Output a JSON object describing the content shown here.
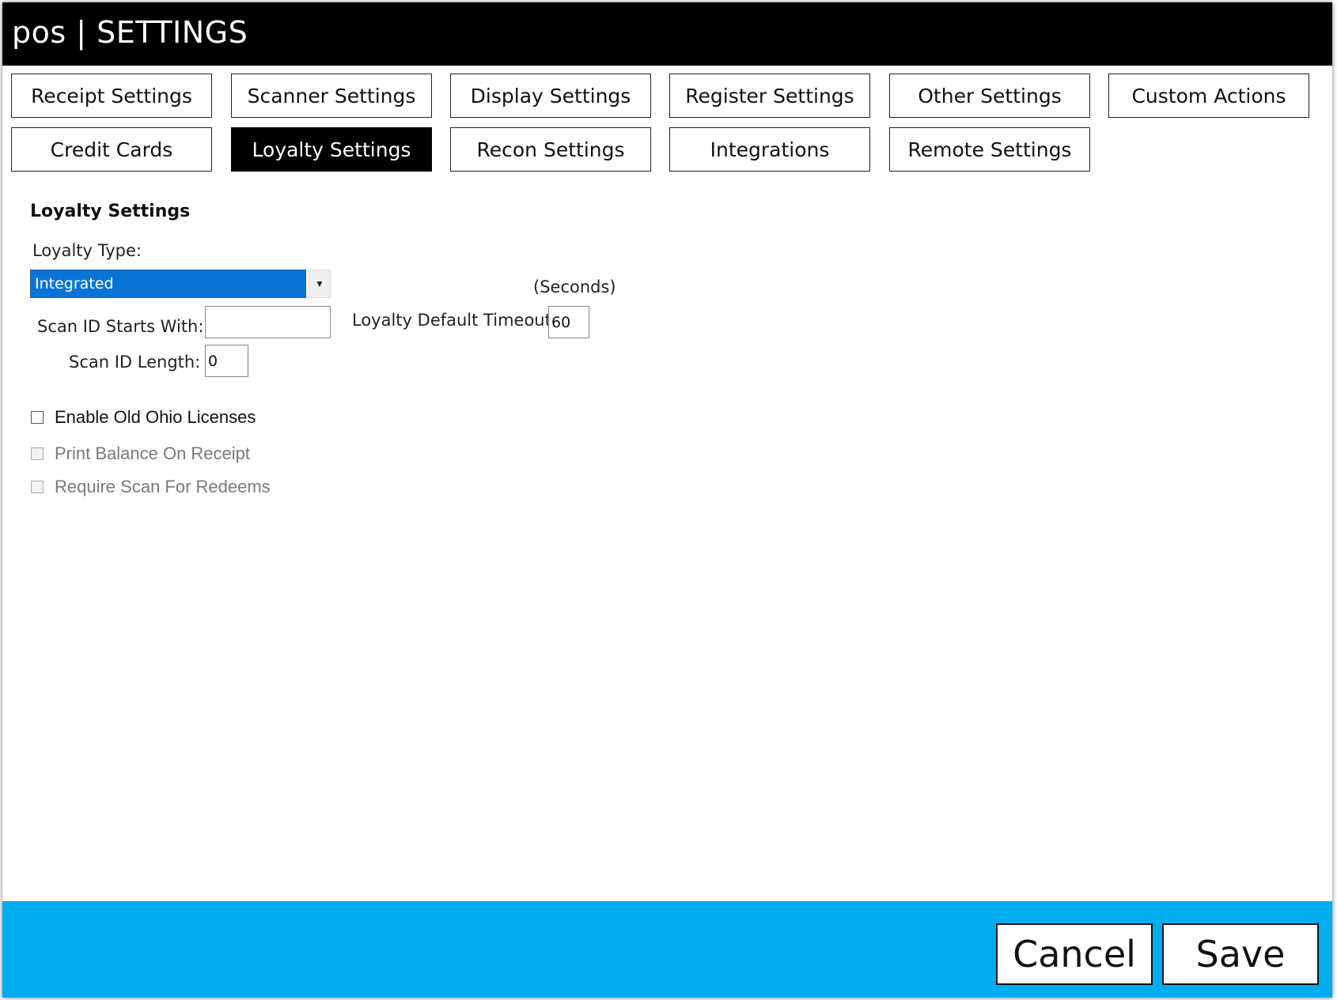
{
  "app": {
    "title": "pos | SETTINGS"
  },
  "tabs": [
    {
      "label": "Receipt Settings",
      "active": false
    },
    {
      "label": "Scanner Settings",
      "active": false
    },
    {
      "label": "Display Settings",
      "active": false
    },
    {
      "label": "Register Settings",
      "active": false
    },
    {
      "label": "Other Settings",
      "active": false
    },
    {
      "label": "Custom Actions",
      "active": false
    },
    {
      "label": "Credit Cards",
      "active": false
    },
    {
      "label": "Loyalty Settings",
      "active": true
    },
    {
      "label": "Recon Settings",
      "active": false
    },
    {
      "label": "Integrations",
      "active": false
    },
    {
      "label": "Remote Settings",
      "active": false
    }
  ],
  "loyalty": {
    "section_title": "Loyalty Settings",
    "type_label": "Loyalty Type:",
    "type_value": "Integrated",
    "scan_id_starts_with_label": "Scan ID Starts With:",
    "scan_id_starts_with_value": "",
    "scan_id_length_label": "Scan ID Length:",
    "scan_id_length_value": "0",
    "timeout_label": "Loyalty Default Timeout:",
    "timeout_value": "60",
    "timeout_unit": "(Seconds)",
    "checkboxes": [
      {
        "label": "Enable Old Ohio Licenses",
        "checked": false,
        "enabled": true
      },
      {
        "label": "Print Balance On Receipt",
        "checked": false,
        "enabled": false
      },
      {
        "label": "Require Scan For Redeems",
        "checked": false,
        "enabled": false
      }
    ]
  },
  "footer": {
    "cancel_label": "Cancel",
    "save_label": "Save"
  },
  "colors": {
    "titlebar": "#000000",
    "footer": "#00adef",
    "select_highlight": "#0a74d6"
  }
}
